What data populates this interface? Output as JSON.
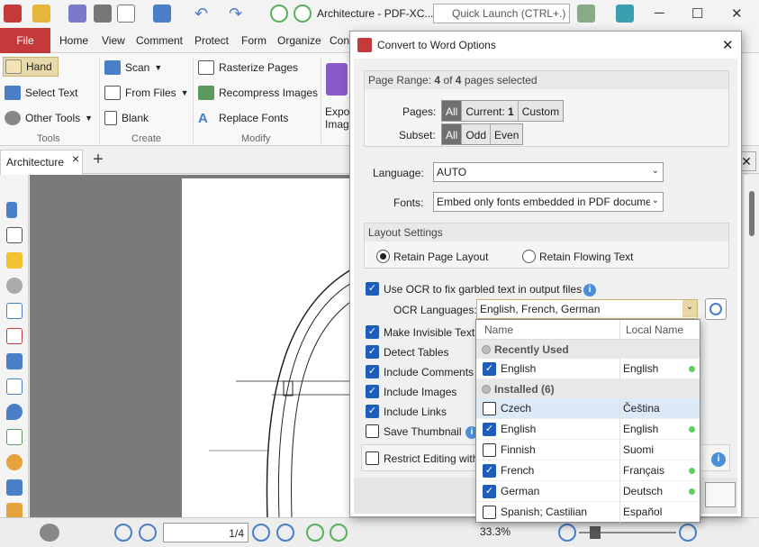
{
  "app": {
    "title": "Architecture - PDF-XC...",
    "quick_launch_placeholder": "Quick Launch (CTRL+.)",
    "minimize": "─",
    "maximize": "☐",
    "close": "✕"
  },
  "ribbon_tabs": {
    "file": "File",
    "home": "Home",
    "view": "View",
    "comment": "Comment",
    "protect": "Protect",
    "form": "Form",
    "organize": "Organize",
    "convert": "Con"
  },
  "ribbon": {
    "tools": {
      "hand": "Hand",
      "select_text": "Select Text",
      "other_tools": "Other Tools",
      "label": "Tools"
    },
    "create": {
      "scan": "Scan",
      "from_files": "From Files",
      "blank": "Blank",
      "label": "Create"
    },
    "modify": {
      "rasterize": "Rasterize Pages",
      "recompress": "Recompress Images",
      "replace_fonts": "Replace Fonts",
      "label": "Modify"
    },
    "export_line1": "Expo",
    "export_line2": "Imag"
  },
  "doc_tab": {
    "name": "Architecture",
    "close": "×",
    "add": "+"
  },
  "status": {
    "page_value": "1",
    "page_total": "/4",
    "zoom": "33.3%"
  },
  "dialog": {
    "title": "Convert to Word Options",
    "close": "✕",
    "page_range": {
      "header_prefix": "Page Range:",
      "header_count": "4",
      "header_of": "of",
      "header_total": "4",
      "header_suffix": "pages selected",
      "pages_label": "Pages:",
      "pages_options": {
        "all": "All",
        "current_label": "Current:",
        "current_num": "1",
        "custom": "Custom"
      },
      "subset_label": "Subset:",
      "subset_options": {
        "all": "All",
        "odd": "Odd",
        "even": "Even"
      }
    },
    "language_label": "Language:",
    "language_value": "AUTO",
    "fonts_label": "Fonts:",
    "fonts_value": "Embed only fonts embedded in PDF docume",
    "layout": {
      "header": "Layout Settings",
      "retain_page": "Retain Page Layout",
      "retain_flowing": "Retain Flowing Text"
    },
    "ocr": {
      "use_ocr": "Use OCR to fix garbled text in output files",
      "languages_label": "OCR Languages:",
      "languages_value": "English, French, German"
    },
    "options": {
      "invisible_text": "Make Invisible Text V",
      "detect_tables": "Detect Tables",
      "include_comments": "Include Comments",
      "include_images": "Include Images",
      "include_links": "Include Links",
      "save_thumbnail": "Save Thumbnail",
      "restrict_editing": "Restrict Editing with"
    }
  },
  "ocr_dropdown": {
    "col_name": "Name",
    "col_local": "Local Name",
    "recent_header": "Recently Used",
    "installed_header": "Installed (6)",
    "recent": [
      {
        "name": "English",
        "local": "English",
        "checked": true
      }
    ],
    "installed": [
      {
        "name": "Czech",
        "local": "Čeština",
        "checked": false
      },
      {
        "name": "English",
        "local": "English",
        "checked": true
      },
      {
        "name": "Finnish",
        "local": "Suomi",
        "checked": false
      },
      {
        "name": "French",
        "local": "Français",
        "checked": true
      },
      {
        "name": "German",
        "local": "Deutsch",
        "checked": true
      },
      {
        "name": "Spanish; Castilian",
        "local": "Español",
        "checked": false
      }
    ]
  },
  "colors": {
    "file_tab": "#c43a3a",
    "accent": "#1e5db8",
    "selected_seg": "#707070"
  }
}
